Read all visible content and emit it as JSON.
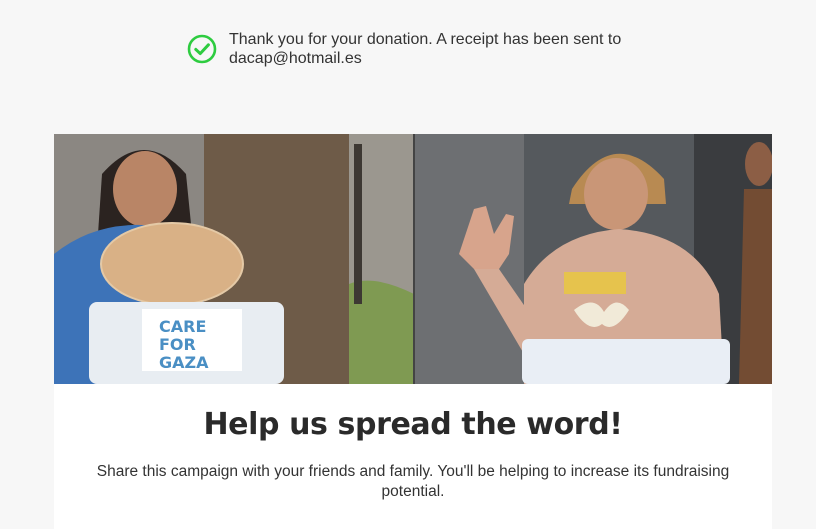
{
  "notice": {
    "icon": "check-circle-icon",
    "color": "#2ecc40",
    "line1": "Thank you for your donation. A receipt has been sent to",
    "line2": "dacap@hotmail.es"
  },
  "card": {
    "image": {
      "alt": "Children holding food aid packages",
      "package_logo_text": [
        "CARE",
        "FOR",
        "GAZA"
      ]
    },
    "headline": "Help us spread the word!",
    "subtext": "Share this campaign with your friends and family. You'll be helping to increase its fundraising potential."
  }
}
